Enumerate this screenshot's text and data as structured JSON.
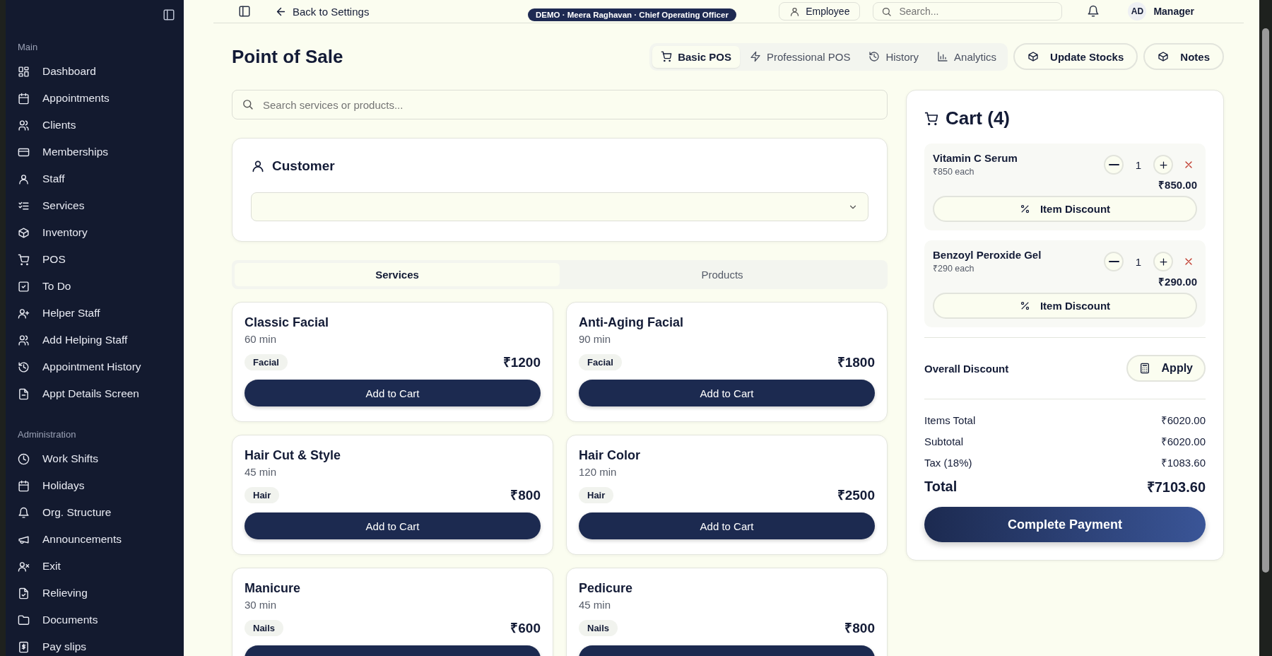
{
  "sidebar": {
    "sections": [
      {
        "title": "Main",
        "items": [
          {
            "label": "Dashboard"
          },
          {
            "label": "Appointments"
          },
          {
            "label": "Clients"
          },
          {
            "label": "Memberships"
          },
          {
            "label": "Staff"
          },
          {
            "label": "Services"
          },
          {
            "label": "Inventory"
          },
          {
            "label": "POS"
          },
          {
            "label": "To Do"
          },
          {
            "label": "Helper Staff"
          },
          {
            "label": "Add Helping Staff"
          },
          {
            "label": "Appointment History"
          },
          {
            "label": "Appt Details Screen"
          }
        ]
      },
      {
        "title": "Administration",
        "items": [
          {
            "label": "Work Shifts"
          },
          {
            "label": "Holidays"
          },
          {
            "label": "Org. Structure"
          },
          {
            "label": "Announcements"
          },
          {
            "label": "Exit"
          },
          {
            "label": "Relieving"
          },
          {
            "label": "Documents"
          },
          {
            "label": "Pay slips"
          }
        ]
      }
    ]
  },
  "top_bar": {
    "back_link": "Back to Settings",
    "badge": "DEMO · Meera Raghavan · Chief Operating Officer",
    "role_button": "Employee",
    "search": {
      "placeholder": "Search..."
    },
    "avatar": "AD",
    "user_role": "Manager"
  },
  "page": {
    "title": "Point of Sale",
    "view_tabs": [
      {
        "label": "Basic POS",
        "selected": true
      },
      {
        "label": "Professional POS",
        "selected": false
      },
      {
        "label": "History",
        "selected": false
      },
      {
        "label": "Analytics",
        "selected": false
      }
    ],
    "actions": [
      "Update Stocks",
      "Notes"
    ]
  },
  "search": {
    "placeholder": "Search services or products..."
  },
  "customer": {
    "title": "Customer"
  },
  "catalog_tabs": [
    {
      "label": "Services",
      "selected": true
    },
    {
      "label": "Products",
      "selected": false
    }
  ],
  "items": [
    {
      "name": "Classic Facial",
      "duration": "60 min",
      "category": "Facial",
      "price": "₹1200",
      "button": "Add to Cart"
    },
    {
      "name": "Anti-Aging Facial",
      "duration": "90 min",
      "category": "Facial",
      "price": "₹1800",
      "button": "Add to Cart"
    },
    {
      "name": "Hair Cut & Style",
      "duration": "45 min",
      "category": "Hair",
      "price": "₹800",
      "button": "Add to Cart"
    },
    {
      "name": "Hair Color",
      "duration": "120 min",
      "category": "Hair",
      "price": "₹2500",
      "button": "Add to Cart"
    },
    {
      "name": "Manicure",
      "duration": "30 min",
      "category": "Nails",
      "price": "₹600"
    },
    {
      "name": "Pedicure",
      "duration": "45 min",
      "category": "Nails",
      "price": "₹800"
    }
  ],
  "cart": {
    "title": "Cart (4)",
    "lines": [
      {
        "name": "Vitamin C Serum",
        "unit_price": "₹850 each",
        "quantity": "1",
        "line_total": "₹850.00",
        "discount_button": "Item Discount"
      },
      {
        "name": "Benzoyl Peroxide Gel",
        "unit_price": "₹290 each",
        "quantity": "1",
        "line_total": "₹290.00",
        "discount_button": "Item Discount"
      }
    ],
    "overall_discount": {
      "label": "Overall Discount",
      "button": "Apply"
    },
    "summary": [
      {
        "label": "Items Total",
        "value": "₹6020.00"
      },
      {
        "label": "Subtotal",
        "value": "₹6020.00"
      },
      {
        "label": "Tax (18%)",
        "value": "₹1083.60"
      }
    ],
    "total": {
      "label": "Total",
      "value": "₹7103.60"
    },
    "pay_button": "Complete Payment"
  }
}
